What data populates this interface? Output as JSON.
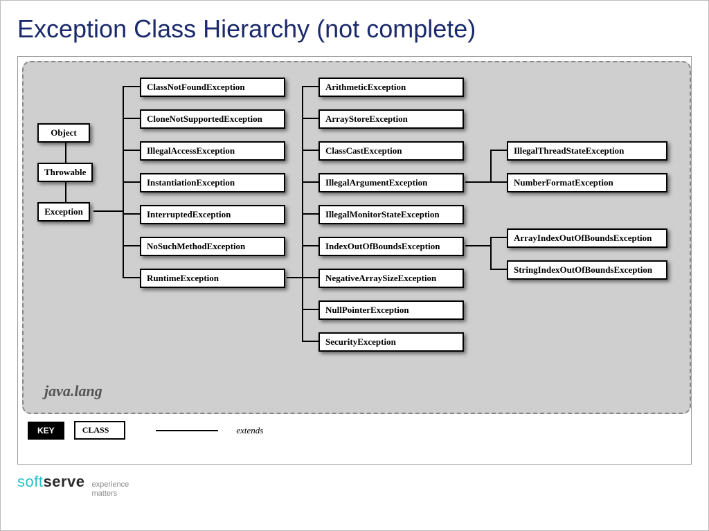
{
  "title": "Exception Class Hierarchy (not complete)",
  "packageLabel": "java.lang",
  "roots": [
    "Object",
    "Throwable",
    "Exception"
  ],
  "col1": [
    "ClassNotFoundException",
    "CloneNotSupportedException",
    "IllegalAccessException",
    "InstantiationException",
    "InterruptedException",
    "NoSuchMethodException",
    "RuntimeException"
  ],
  "col2": [
    "ArithmeticException",
    "ArrayStoreException",
    "ClassCastException",
    "IllegalArgumentException",
    "IllegalMonitorStateException",
    "IndexOutOfBoundsException",
    "NegativeArraySizeException",
    "NullPointerException",
    "SecurityException"
  ],
  "col3a": [
    "IllegalThreadStateException",
    "NumberFormatException"
  ],
  "col3b": [
    "ArrayIndexOutOfBoundsException",
    "StringIndexOutOfBoundsException"
  ],
  "key": {
    "badge": "KEY",
    "classLabel": "CLASS",
    "extendsLabel": "extends"
  },
  "logo": {
    "first": "soft",
    "second": "serve",
    "tag1": "experience",
    "tag2": "matters"
  }
}
